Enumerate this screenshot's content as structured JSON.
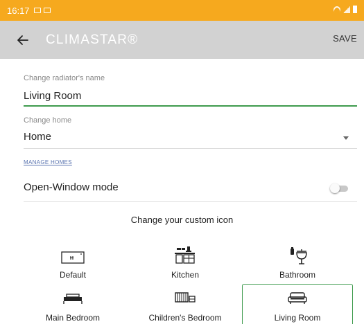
{
  "status_bar": {
    "time": "16:17",
    "background_color": "#f6a91e"
  },
  "app_bar": {
    "title": "CLIMASTAR®",
    "save_label": "SAVE",
    "back_icon": "arrow-left-icon",
    "background_color": "#d2d2d2"
  },
  "name_field": {
    "label": "Change radiator's name",
    "value": "Living Room",
    "accent_color": "#3d9a4c"
  },
  "home_field": {
    "label": "Change home",
    "value": "Home",
    "dropdown_icon": "chevron-down-icon"
  },
  "manage_homes_link": "MANAGE HOMES",
  "open_window": {
    "label": "Open-Window mode",
    "enabled": false
  },
  "icons_section": {
    "heading": "Change your custom icon",
    "items": [
      {
        "label": "Default",
        "icon": "radiator-icon",
        "selected": false
      },
      {
        "label": "Kitchen",
        "icon": "kitchen-icon",
        "selected": false
      },
      {
        "label": "Bathroom",
        "icon": "bathroom-icon",
        "selected": false
      },
      {
        "label": "Main Bedroom",
        "icon": "bed-icon",
        "selected": false
      },
      {
        "label": "Children's Bedroom",
        "icon": "children-bedroom-icon",
        "selected": false
      },
      {
        "label": "Living Room",
        "icon": "sofa-icon",
        "selected": true
      }
    ]
  }
}
